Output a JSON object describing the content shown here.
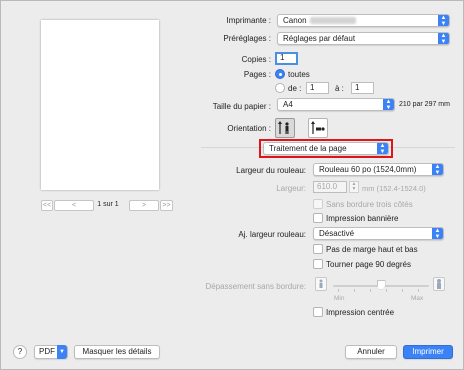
{
  "printer": {
    "label": "Imprimante :",
    "value": "Canon"
  },
  "presets": {
    "label": "Préréglages :",
    "value": "Réglages par défaut"
  },
  "copies": {
    "label": "Copies :",
    "value": "1"
  },
  "pages": {
    "label": "Pages :",
    "all_label": "toutes",
    "from_label": "de :",
    "from_value": "1",
    "to_label": "à :",
    "to_value": "1"
  },
  "paper_size": {
    "label": "Taille du papier :",
    "value": "A4",
    "dims": "210 par 297 mm"
  },
  "orientation": {
    "label": "Orientation :"
  },
  "section_menu": {
    "value": "Traitement de la page"
  },
  "roll_width": {
    "label": "Largeur du rouleau:",
    "value": "Rouleau 60 po (1524,0mm)"
  },
  "width": {
    "label": "Largeur:",
    "value": "610.0",
    "unit": "mm (152.4-1524.0)"
  },
  "borderless_3": {
    "label": "Sans bordure trois côtés"
  },
  "banner": {
    "label": "Impression bannière"
  },
  "fit_roll": {
    "label": "Aj. largeur rouleau:",
    "value": "Désactivé"
  },
  "no_margin": {
    "label": "Pas de marge haut et bas"
  },
  "rotate90": {
    "label": "Tourner page 90 degrés"
  },
  "overflow": {
    "label": "Dépassement sans bordure:",
    "min": "Min",
    "max": "Max",
    "level": 0.5
  },
  "center": {
    "label": "Impression centrée"
  },
  "pager": {
    "first": "<<",
    "prev": "<",
    "text": "1 sur 1",
    "next": ">",
    "last": ">>"
  },
  "footer": {
    "help": "?",
    "pdf": "PDF",
    "details": "Masquer les détails",
    "cancel": "Annuler",
    "print": "Imprimer"
  },
  "colors": {
    "accent": "#3b82f6",
    "highlight": "#e0141b"
  }
}
